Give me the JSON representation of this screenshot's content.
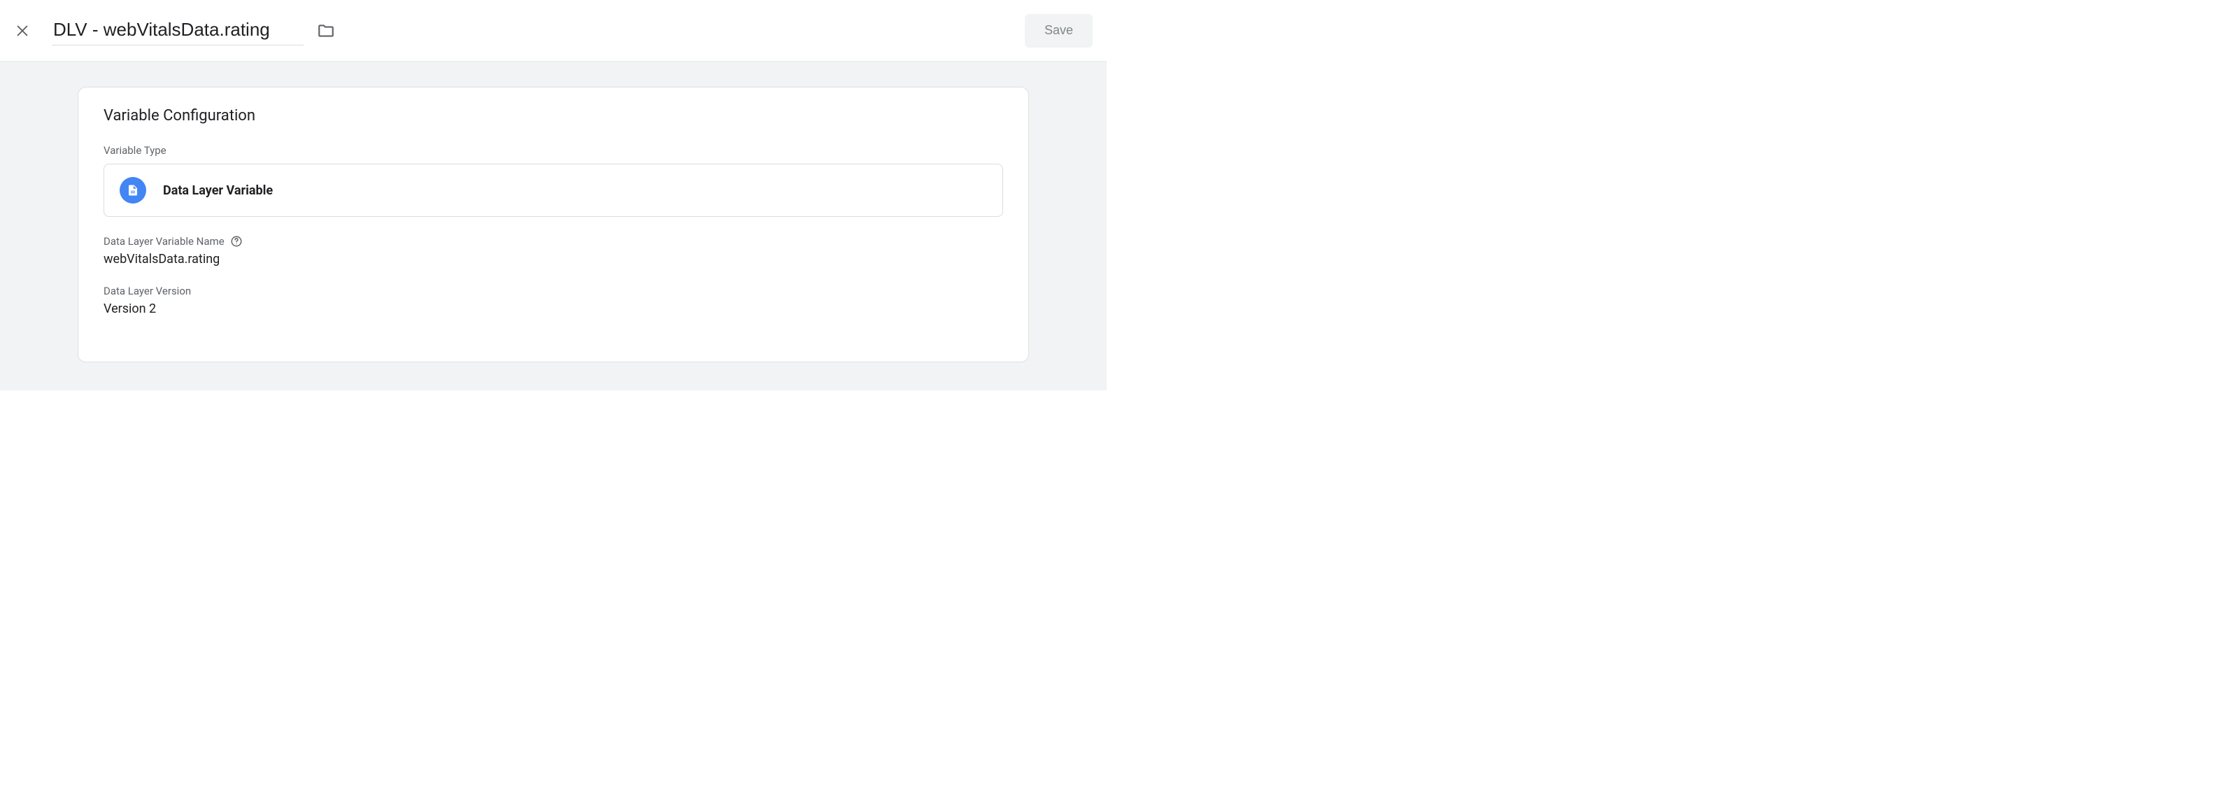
{
  "header": {
    "title": "DLV - webVitalsData.rating",
    "save_label": "Save"
  },
  "card": {
    "heading": "Variable Configuration",
    "type_label": "Variable Type",
    "type_value": "Data Layer Variable",
    "name_label": "Data Layer Variable Name",
    "name_value": "webVitalsData.rating",
    "version_label": "Data Layer Version",
    "version_value": "Version 2"
  }
}
